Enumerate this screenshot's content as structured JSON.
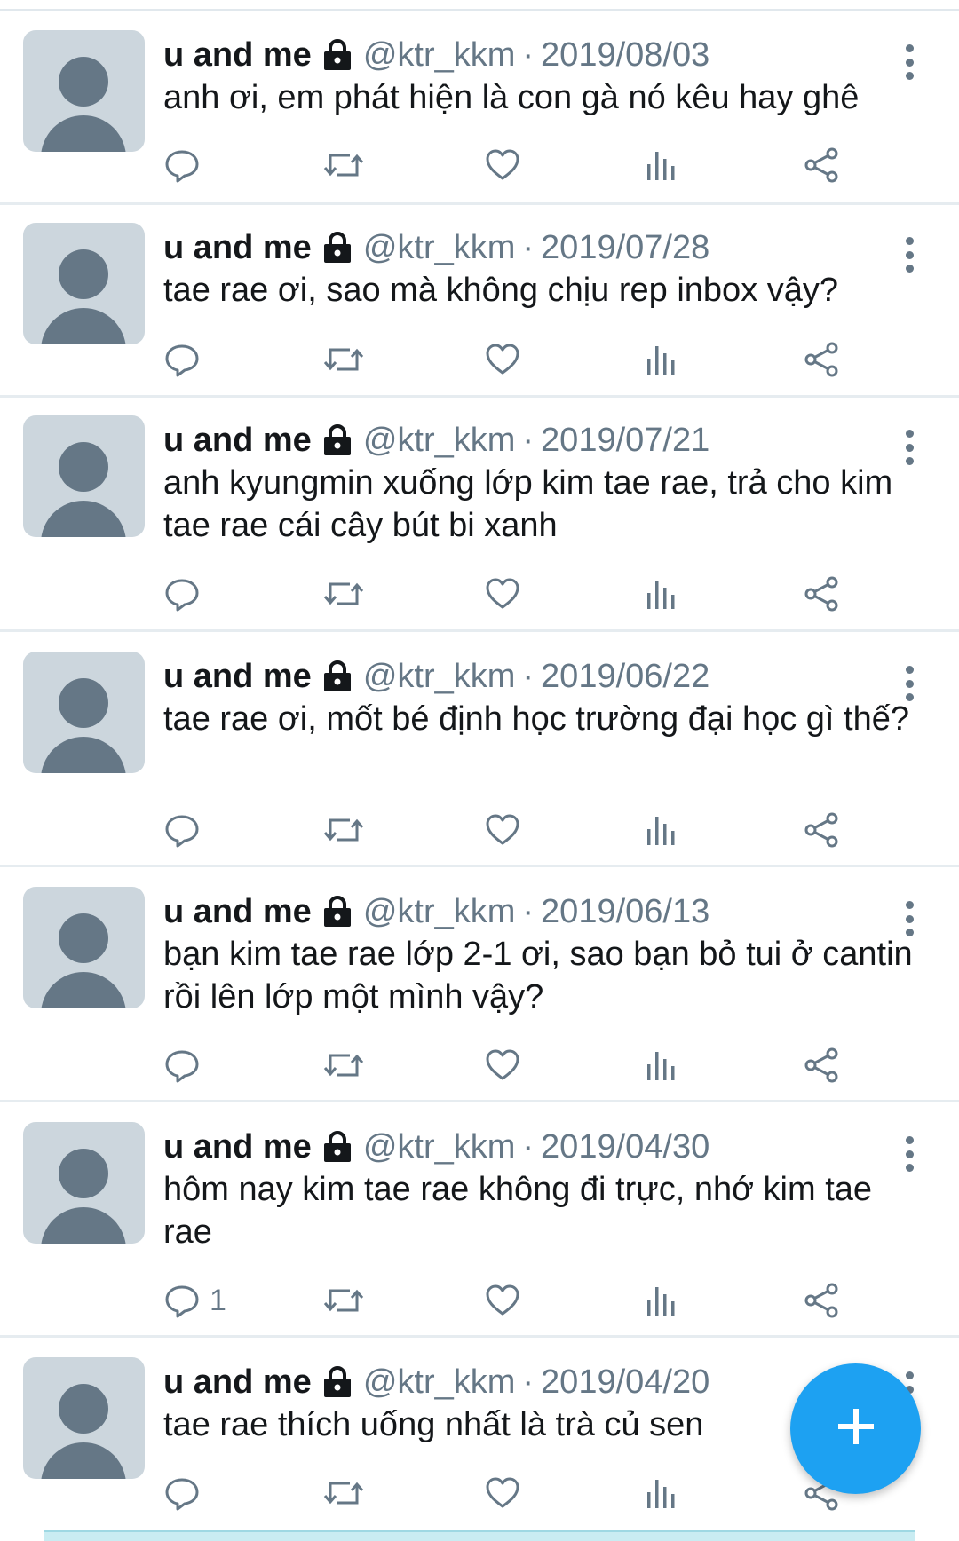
{
  "tweets": [
    {
      "name": "u and me",
      "handle": "@ktr_kkm",
      "sep": "·",
      "date": "2019/08/03",
      "text": "anh ơi, em phát hiện là con gà nó kêu hay ghê",
      "replies": ""
    },
    {
      "name": "u and me",
      "handle": "@ktr_kkm",
      "sep": "·",
      "date": "2019/07/28",
      "text": "tae rae ơi, sao mà không chịu rep inbox vậy?",
      "replies": ""
    },
    {
      "name": "u and me",
      "handle": "@ktr_kkm",
      "sep": "·",
      "date": "2019/07/21",
      "text": "anh kyungmin xuống lớp kim tae rae, trả cho kim tae rae cái cây bút bi xanh",
      "replies": ""
    },
    {
      "name": "u and me",
      "handle": "@ktr_kkm",
      "sep": "·",
      "date": "2019/06/22",
      "text": "tae rae ơi, mốt bé định học trường đại học gì thế?",
      "replies": ""
    },
    {
      "name": "u and me",
      "handle": "@ktr_kkm",
      "sep": "·",
      "date": "2019/06/13",
      "text": "bạn kim tae rae lớp 2-1 ơi, sao bạn bỏ tui ở cantin rồi lên lớp một mình vậy?",
      "replies": ""
    },
    {
      "name": "u and me",
      "handle": "@ktr_kkm",
      "sep": "·",
      "date": "2019/04/30",
      "text": "hôm nay kim tae rae không đi trực, nhớ kim tae rae",
      "replies": "1"
    },
    {
      "name": "u and me",
      "handle": "@ktr_kkm",
      "sep": "·",
      "date": "2019/04/20",
      "text": "tae rae thích uống nhất là trà củ sen",
      "replies": ""
    }
  ],
  "icons": {
    "lock": "lock-icon",
    "reply": "reply-icon",
    "retweet": "retweet-icon",
    "like": "heart-icon",
    "analytics": "analytics-icon",
    "share": "share-icon",
    "more": "more-vertical-icon",
    "compose": "plus-icon"
  },
  "colors": {
    "accent": "#1da1f2",
    "secondary_text": "#657786",
    "primary_text": "#14171a",
    "avatar_bg": "#ccd6dd"
  }
}
